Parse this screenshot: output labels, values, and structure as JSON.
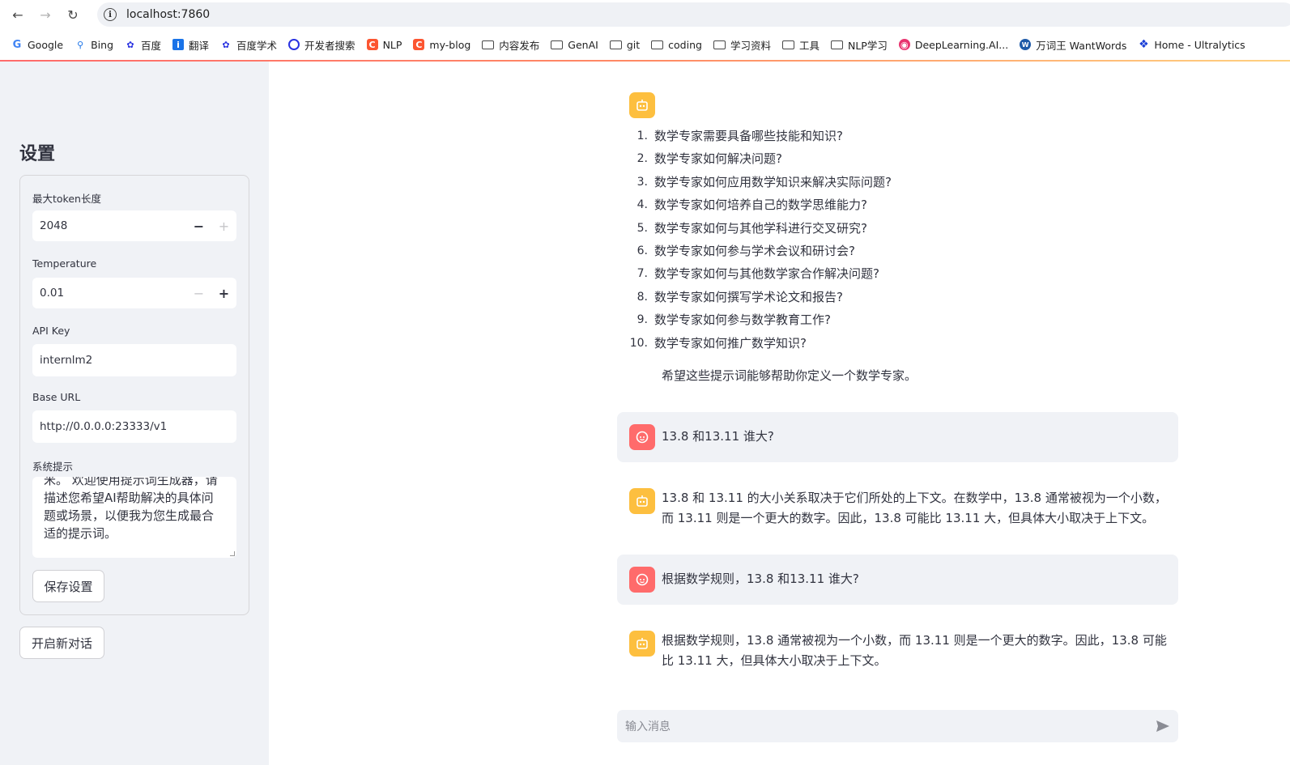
{
  "browser": {
    "url": "localhost:7860",
    "bookmarks": [
      "Google",
      "Bing",
      "百度",
      "翻译",
      "百度学术",
      "开发者搜索",
      "NLP",
      "my-blog",
      "内容发布",
      "GenAI",
      "git",
      "coding",
      "学习资料",
      "工具",
      "NLP学习",
      "DeepLearning.AI...",
      "万词王 WantWords",
      "Home - Ultralytics"
    ]
  },
  "sidebar": {
    "title": "设置",
    "max_token": {
      "label": "最大token长度",
      "value": "2048"
    },
    "temperature": {
      "label": "Temperature",
      "value": "0.01"
    },
    "api_key": {
      "label": "API Key",
      "value": "internlm2"
    },
    "base_url": {
      "label": "Base URL",
      "value": "http://0.0.0.0:23333/v1"
    },
    "system_prompt": {
      "label": "系统提示",
      "value": "米。 欢迎使用提示词生成器，请描述您希望AI帮助解决的具体问题或场景，以便我为您生成最合适的提示词。"
    },
    "save_button": "保存设置",
    "new_chat_button": "开启新对话"
  },
  "chat": {
    "list_items": [
      "数学专家需要具备哪些技能和知识?",
      "数学专家如何解决问题?",
      "数学专家如何应用数学知识来解决实际问题?",
      "数学专家如何培养自己的数学思维能力?",
      "数学专家如何与其他学科进行交叉研究?",
      "数学专家如何参与学术会议和研讨会?",
      "数学专家如何与其他数学家合作解决问题?",
      "数学专家如何撰写学术论文和报告?",
      "数学专家如何参与数学教育工作?",
      "数学专家如何推广数学知识?"
    ],
    "list_numbers": [
      "1.",
      "2.",
      "3.",
      "4.",
      "5.",
      "6.",
      "7.",
      "8.",
      "9.",
      "10."
    ],
    "closing": "希望这些提示词能够帮助你定义一个数学专家。",
    "user_msg_1": "13.8 和13.11 谁大?",
    "bot_msg_1": "13.8 和 13.11 的大小关系取决于它们所处的上下文。在数学中，13.8 通常被视为一个小数，而 13.11 则是一个更大的数字。因此，13.8 可能比 13.11 大，但具体大小取决于上下文。",
    "user_msg_2": "根据数学规则，13.8 和13.11 谁大?",
    "bot_msg_2": "根据数学规则，13.8 通常被视为一个小数，而 13.11 则是一个更大的数字。因此，13.8 可能比 13.11 大，但具体大小取决于上下文。",
    "input_placeholder": "输入消息"
  }
}
